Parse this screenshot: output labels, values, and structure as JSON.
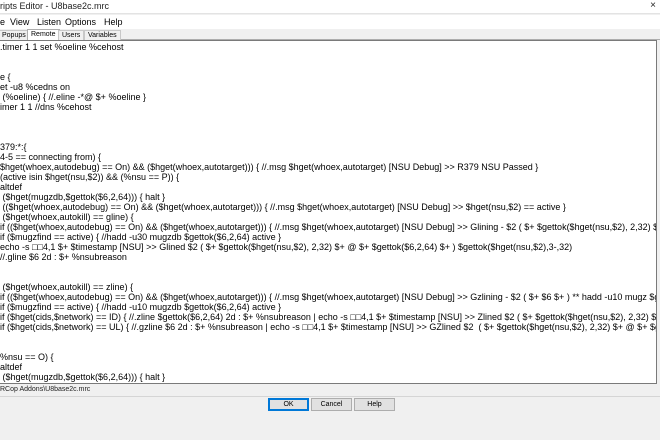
{
  "window": {
    "title": "ripts Editor - U8base2c.mrc",
    "close_glyph": "×"
  },
  "menu": [
    "e",
    "View",
    "Listen",
    "Options",
    "Help"
  ],
  "tabs": [
    {
      "label": "Popups",
      "active": false
    },
    {
      "label": "Remote",
      "active": true
    },
    {
      "label": "Users",
      "active": false
    },
    {
      "label": "Variables",
      "active": false
    }
  ],
  "code_lines": [
    ".timer 1 1 set %oeline %cehost",
    "",
    "",
    "e {",
    "et -u8 %cedns on",
    " (%oeline) { //.eline -*@ $+ %oeline }",
    "imer 1 1 //dns %cehost",
    "",
    "",
    "",
    "379:*:{",
    "4-5 == connecting from) {",
    "$hget(whoex,autodebug) == On) && ($hget(whoex,autotarget))) { //.msg $hget(whoex,autotarget) [NSU Debug] >> R379 NSU Passed }",
    "(active isin $hget(nsu,$2)) && (%nsu == P)) {",
    "altdef",
    " ($hget(mugzdb,$gettok($6,2,64))) { halt }",
    " (($hget(whoex,autodebug) == On) && ($hget(whoex,autotarget))) { //.msg $hget(whoex,autotarget) [NSU Debug] >> $hget(nsu,$2) == active }",
    " ($hget(whoex,autokill) == gline) {",
    "if (($hget(whoex,autodebug) == On) && ($hget(whoex,autotarget))) { //.msg $hget(whoex,autotarget) [NSU Debug] >> Glining - $2 ( $+ $gettok($hget(nsu,$2), 2,32) $+ @ $+",
    "if ($mugzfind == active) { //hadd -u30 mugzdb $gettok($6,2,64) active }",
    "echo -s □□4,1 $+ $timestamp [NSU] >> Glined $2 ( $+ $gettok($hget(nsu,$2), 2,32) $+ @ $+ $gettok($6,2,64) $+ ) $gettok($hget(nsu,$2),3-,32)",
    "//.gline $6 2d : $+ %nsubreason",
    "",
    "",
    " ($hget(whoex,autokill) == zline) {",
    "if (($hget(whoex,autodebug) == On) && ($hget(whoex,autotarget))) { //.msg $hget(whoex,autotarget) [NSU Debug] >> Gzlining - $2 ( $+ $6 $+ ) ** hadd -u10 mugz $gettok(",
    "if ($mugzfind == active) { //hadd -u10 mugzdb $gettok($6,2,64) active }",
    "if ($hget(cids,$network) == ID) { //.zline $gettok($6,2,64) 2d : $+ %nsubreason | echo -s □□4,1 $+ $timestamp [NSU] >> Zlined $2 ( $+ $gettok($hget(nsu,$2), 2,32) $+ @",
    "if ($hget(cids,$network) == UL) { //.gzline $6 2d : $+ %nsubreason | echo -s □□4,1 $+ $timestamp [NSU] >> GZlined $2  ( $+ $gettok($hget(nsu,$2), 2,32) $+ @ $+ $gettok",
    "",
    "",
    "%nsu == O) {",
    "altdef",
    " ($hget(mugzdb,$gettok($6,2,64))) { halt }",
    " (($hget(whoex,autodebug) == On) && ($hget(whoex,autotarget))) { //.msg $hget(whoex,autotarget) [NSU Debug] >> $hget(nsu,$2) == active }",
    " ($hget(whoex,autokill) == gline) {",
    "if (($hget(whoex,autodebug) == On) && ($hget(whoex,autotarget))) { //.msg $hget(whoex,autotarget) [NSU Debug] >> Glining - $2 ( $+ $gettok($hget(nsu,$2), 2,32) $+ @ $+",
    "if ($mugzfind == active) { //hadd -u30 mugzdb $gettok($6,2,64) active }"
  ],
  "status": {
    "file_path": "RCop Addons\\U8base2c.mrc"
  },
  "buttons": {
    "ok": "OK",
    "cancel": "Cancel",
    "help": "Help"
  }
}
